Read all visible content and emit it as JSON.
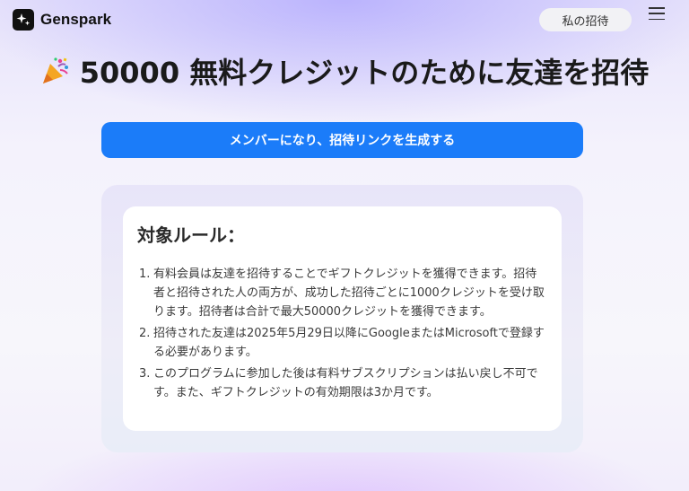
{
  "header": {
    "brand": "Genspark",
    "logo_icon": "sparkle-icon",
    "invite_label": "私の招待",
    "menu_icon": "hamburger-menu-icon"
  },
  "hero": {
    "emoji_icon": "party-popper-icon",
    "title": "50000 無料クレジットのために友達を招待"
  },
  "cta": {
    "label": "メンバーになり、招待リンクを生成する"
  },
  "rules": {
    "title": "対象ルール：",
    "items": [
      {
        "num": "1.",
        "text": "有料会員は友達を招待することでギフトクレジットを獲得できます。招待者と招待された人の両方が、成功した招待ごとに1000クレジットを受け取ります。招待者は合計で最大50000クレジットを獲得できます。"
      },
      {
        "num": "2.",
        "text": "招待された友達は2025年5月29日以降にGoogleまたはMicrosoftで登録する必要があります。"
      },
      {
        "num": "3.",
        "text": "このプログラムに参加した後は有料サブスクリプションは払い戻し不可です。また、ギフトクレジットの有効期限は3か月です。"
      }
    ]
  },
  "colors": {
    "accent": "#1b7cf9",
    "brand_dark": "#111111"
  }
}
